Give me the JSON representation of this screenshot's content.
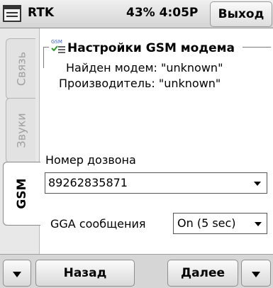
{
  "titlebar": {
    "app_title": "RTK",
    "status": "43% 4:05P",
    "exit_label": "Выход",
    "start_icon": "windows-start-icon"
  },
  "tabs": [
    {
      "label": "Связь",
      "active": false
    },
    {
      "label": "Звуки",
      "active": false
    },
    {
      "label": "GSM",
      "active": true
    }
  ],
  "group": {
    "title": "Настройки GSM модема",
    "icon": "gsm-modem-icon",
    "icon_text": "GSM",
    "modem_found": "Найден модем: \"unknown\"",
    "manufacturer": "Производитель: \"unknown\""
  },
  "dial": {
    "label": "Номер дозвона",
    "value": "89262835871"
  },
  "gga": {
    "label": "GGA сообщения",
    "value": "On (5 sec)"
  },
  "bottombar": {
    "back_label": "Назад",
    "next_label": "Далее",
    "left_arrow_icon": "chevron-down-icon",
    "right_arrow_icon": "chevron-down-icon"
  }
}
